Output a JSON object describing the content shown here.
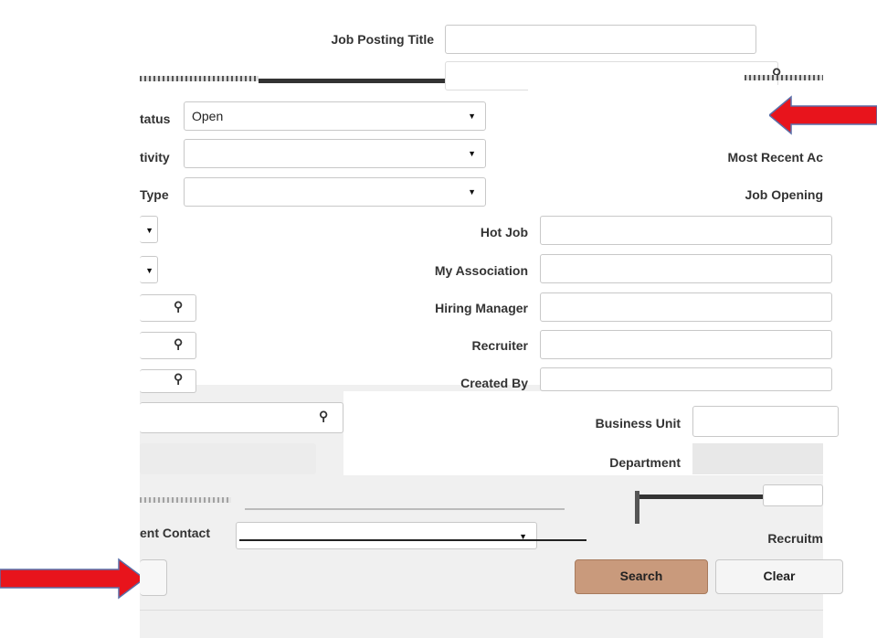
{
  "form": {
    "job_posting_title_label": "Job Posting Title",
    "status_label": "tatus",
    "status_value": "Open",
    "activity_label": "tivity",
    "type_label": "Type",
    "most_recent_label": "Most Recent Ac",
    "job_opening_label": "Job Opening",
    "hot_job_label": "Hot Job",
    "my_association_label": "My Association",
    "hiring_manager_label": "Hiring Manager",
    "recruiter_label": "Recruiter",
    "created_by_label": "Created By",
    "business_unit_label": "Business Unit",
    "department_label": "Department",
    "recruiting_label": "Recruitm",
    "dept_contact_label": "ent Contact"
  },
  "buttons": {
    "search": "Search",
    "clear": "Clear"
  },
  "colors": {
    "arrow": "#e8141c",
    "search_button": "#c99a7c"
  },
  "icons": [
    "magnifier-icon",
    "dropdown-caret-icon",
    "right-arrow-icon",
    "left-arrow-icon"
  ]
}
